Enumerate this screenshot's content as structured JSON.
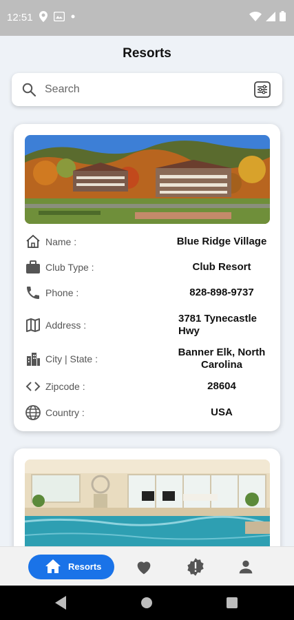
{
  "status_bar": {
    "time": "12:51",
    "left_icons": [
      "location-icon",
      "image-icon",
      "dot-icon"
    ],
    "right_icons": [
      "wifi-icon",
      "signal-icon",
      "battery-icon"
    ]
  },
  "header": {
    "title": "Resorts"
  },
  "search": {
    "placeholder": "Search",
    "value": ""
  },
  "resorts": [
    {
      "image": "mountain-resort-photo",
      "fields": [
        {
          "icon": "home-outline-icon",
          "label": "Name :",
          "value": "Blue Ridge Village"
        },
        {
          "icon": "briefcase-icon",
          "label": "Club Type :",
          "value": "Club Resort"
        },
        {
          "icon": "phone-icon",
          "label": "Phone :",
          "value": "828-898-9737"
        },
        {
          "icon": "map-icon",
          "label": "Address :",
          "value": "3781 Tynecastle Hwy"
        },
        {
          "icon": "city-icon",
          "label": "City | State :",
          "value": "Banner Elk, North Carolina"
        },
        {
          "icon": "code-icon",
          "label": "Zipcode :",
          "value": "28604"
        },
        {
          "icon": "globe-icon",
          "label": "Country :",
          "value": "USA"
        }
      ]
    },
    {
      "image": "indoor-pool-photo"
    }
  ],
  "bottom_nav": {
    "items": [
      {
        "icon": "home-icon",
        "label": "Resorts",
        "active": true
      },
      {
        "icon": "heart-icon",
        "active": false
      },
      {
        "icon": "alert-badge-icon",
        "active": false
      },
      {
        "icon": "person-icon",
        "active": false
      }
    ]
  },
  "colors": {
    "accent": "#1a73e8",
    "background": "#eef2f7",
    "card": "#ffffff"
  }
}
